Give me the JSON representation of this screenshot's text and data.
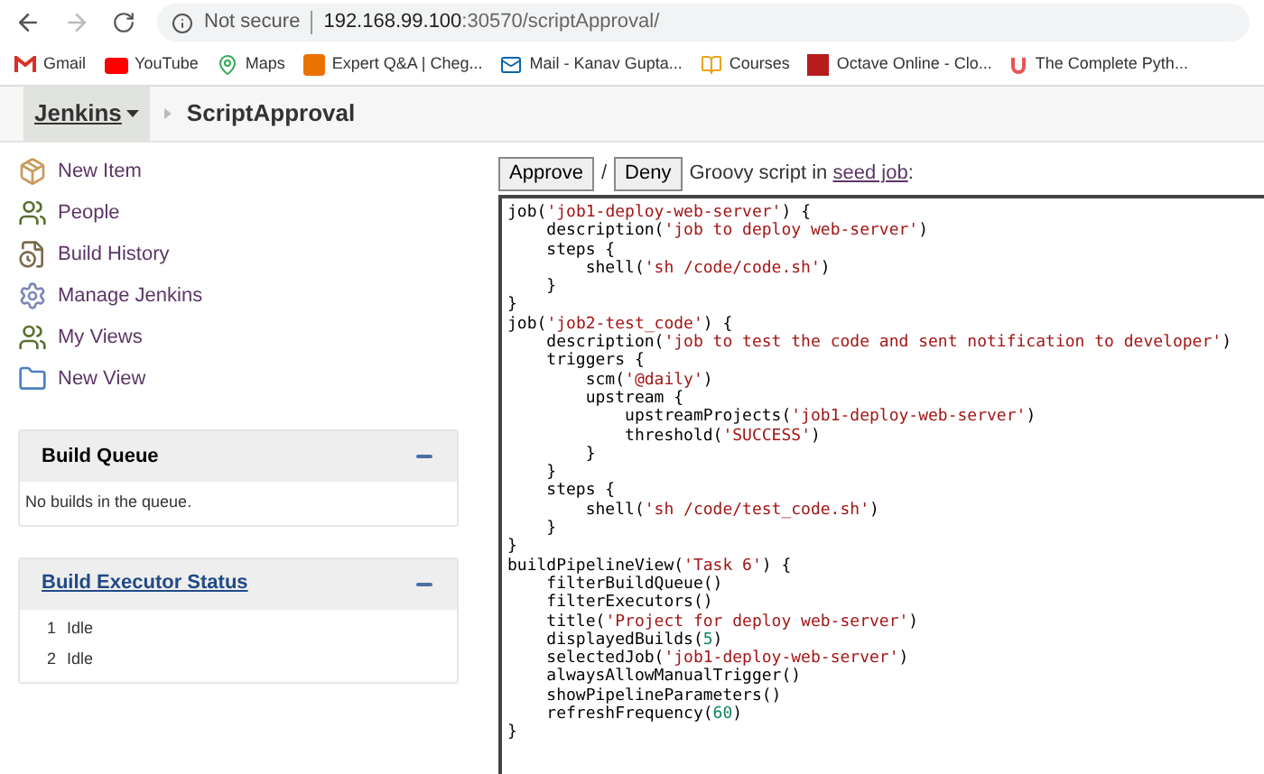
{
  "browser": {
    "security": "Not secure",
    "host": "192.168.99.100",
    "path": ":30570/scriptApproval/",
    "bookmarks": [
      {
        "label": "Gmail"
      },
      {
        "label": "YouTube"
      },
      {
        "label": "Maps"
      },
      {
        "label": "Expert Q&A | Cheg..."
      },
      {
        "label": "Mail - Kanav Gupta..."
      },
      {
        "label": "Courses"
      },
      {
        "label": "Octave Online - Clo..."
      },
      {
        "label": "The Complete Pyth..."
      }
    ]
  },
  "header": {
    "breadcrumbs": [
      "Jenkins",
      "ScriptApproval"
    ]
  },
  "sidebar": {
    "items": [
      {
        "label": "New Item"
      },
      {
        "label": "People"
      },
      {
        "label": "Build History"
      },
      {
        "label": "Manage Jenkins"
      },
      {
        "label": "My Views"
      },
      {
        "label": "New View"
      }
    ]
  },
  "build_queue": {
    "title": "Build Queue",
    "message": "No builds in the queue."
  },
  "executor_status": {
    "title": "Build Executor Status",
    "executors": [
      {
        "number": "1",
        "status": "Idle"
      },
      {
        "number": "2",
        "status": "Idle"
      }
    ]
  },
  "approval": {
    "buttons": [
      "Approve",
      "Deny"
    ],
    "separator": "/",
    "text": "Groovy script in",
    "link": "seed job",
    "suffix": ":",
    "code": [
      "job('job1-deploy-web-server') {",
      "    description('job to deploy web-server')",
      "    steps {",
      "        shell('sh /code/code.sh')",
      "    }",
      "}",
      "job('job2-test_code') {",
      "    description('job to test the code and sent notification to developer')",
      "    triggers {",
      "        scm('@daily')",
      "        upstream {",
      "            upstreamProjects('job1-deploy-web-server')",
      "            threshold('SUCCESS')",
      "        }",
      "    }",
      "    steps {",
      "        shell('sh /code/test_code.sh')",
      "    }",
      "}",
      "buildPipelineView('Task 6') {",
      "    filterBuildQueue()",
      "    filterExecutors()",
      "    title('Project for deploy web-server')",
      "    displayedBuilds(5)",
      "    selectedJob('job1-deploy-web-server')",
      "    alwaysAllowManualTrigger()",
      "    showPipelineParameters()",
      "    refreshFrequency(60)",
      "}"
    ]
  }
}
